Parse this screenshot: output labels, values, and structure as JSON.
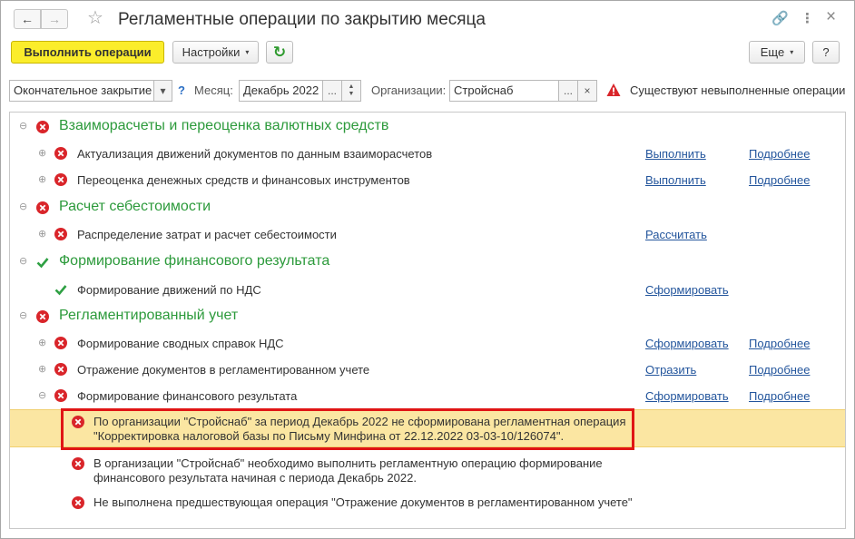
{
  "window": {
    "title": "Регламентные операции по закрытию месяца",
    "nav_back": "←",
    "nav_forward": "→",
    "star": "☆",
    "link_icon": "🔗",
    "more_icon": "⋮",
    "close_icon": "×"
  },
  "toolbar": {
    "run_label": "Выполнить операции",
    "settings_label": "Настройки",
    "more_label": "Еще",
    "help_label": "?",
    "refresh_icon": "↻",
    "caret": "▾"
  },
  "filters": {
    "mode_value": "Окончательное закрытие",
    "help": "?",
    "month_label": "Месяц:",
    "month_value": "Декабрь 2022",
    "org_label": "Организации:",
    "org_value": "Стройснаб",
    "ellipsis": "...",
    "clear": "×",
    "warning_text": "Существуют невыполненные операции"
  },
  "groups": [
    {
      "label": "Взаиморасчеты и переоценка валютных средств",
      "status": "error"
    },
    {
      "label": "Расчет себестоимости",
      "status": "error"
    },
    {
      "label": "Формирование финансового результата",
      "status": "ok"
    },
    {
      "label": "Регламентированный учет",
      "status": "error"
    }
  ],
  "items": [
    {
      "label": "Актуализация движений документов по данным взаиморасчетов",
      "action": "Выполнить",
      "details": "Подробнее",
      "status": "error"
    },
    {
      "label": "Переоценка денежных средств и финансовых инструментов",
      "action": "Выполнить",
      "details": "Подробнее",
      "status": "error"
    },
    {
      "label": "Распределение затрат и расчет себестоимости",
      "action": "Рассчитать",
      "status": "error"
    },
    {
      "label": "Формирование движений по НДС",
      "action": "Сформировать",
      "status": "ok"
    },
    {
      "label": "Формирование сводных справок НДС",
      "action": "Сформировать",
      "details": "Подробнее",
      "status": "error"
    },
    {
      "label": "Отражение документов в регламентированном учете",
      "action": "Отразить",
      "details": "Подробнее",
      "status": "error"
    },
    {
      "label": "Формирование финансового результата",
      "action": "Сформировать",
      "details": "Подробнее",
      "status": "error"
    }
  ],
  "messages": [
    {
      "line1": "По организации \"Стройснаб\" за период Декабрь 2022 не сформирована регламентная операция",
      "line2": "\"Корректировка налоговой базы по Письму Минфина от 22.12.2022 03-03-10/126074\"."
    },
    {
      "line1": "В организации \"Стройснаб\" необходимо выполнить регламентную операцию формирование",
      "line2": "финансового результата начиная с периода Декабрь 2022."
    },
    {
      "line1": "Не выполнена предшествующая операция \"Отражение документов в регламентированном учете\"",
      "line2": ""
    }
  ],
  "tree": {
    "expand": "⊕",
    "collapse": "⊖"
  },
  "colors": {
    "error": "#d9252a",
    "ok": "#2ea043",
    "group_text": "#2c9a3b",
    "link": "#23559c",
    "highlight": "#fbe6a2",
    "primary_button": "#fbed2b"
  }
}
